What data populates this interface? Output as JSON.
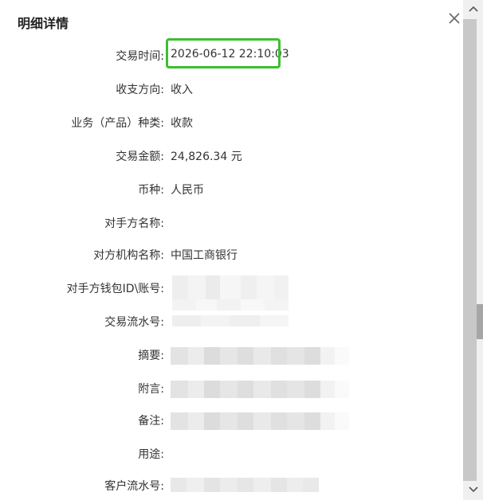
{
  "dialog": {
    "title": "明细详情",
    "close_icon": "close-icon"
  },
  "fields": [
    {
      "label": "交易时间:",
      "value": "2026-06-12 22:10:03"
    },
    {
      "label": "收支方向:",
      "value": "收入"
    },
    {
      "label": "业务（产品）种类:",
      "value": "收款"
    },
    {
      "label": "交易金额:",
      "value": "24,826.34 元"
    },
    {
      "label": "币种:",
      "value": "人民币"
    },
    {
      "label": "对手方名称:",
      "value": ""
    },
    {
      "label": "对方机构名称:",
      "value": "中国工商银行"
    },
    {
      "label": "对手方钱包ID\\账号:",
      "value": ""
    },
    {
      "label": "交易流水号:",
      "value": ""
    },
    {
      "label": "摘要:",
      "value": ""
    },
    {
      "label": "附言:",
      "value": ""
    },
    {
      "label": "备注:",
      "value": ""
    },
    {
      "label": "用途:",
      "value": ""
    },
    {
      "label": "客户流水号:",
      "value": ""
    }
  ],
  "highlight_color": "#3cbf30",
  "scrollbar": {
    "up_icon": "chevron-up-icon",
    "down_icon": "chevron-down-icon"
  }
}
